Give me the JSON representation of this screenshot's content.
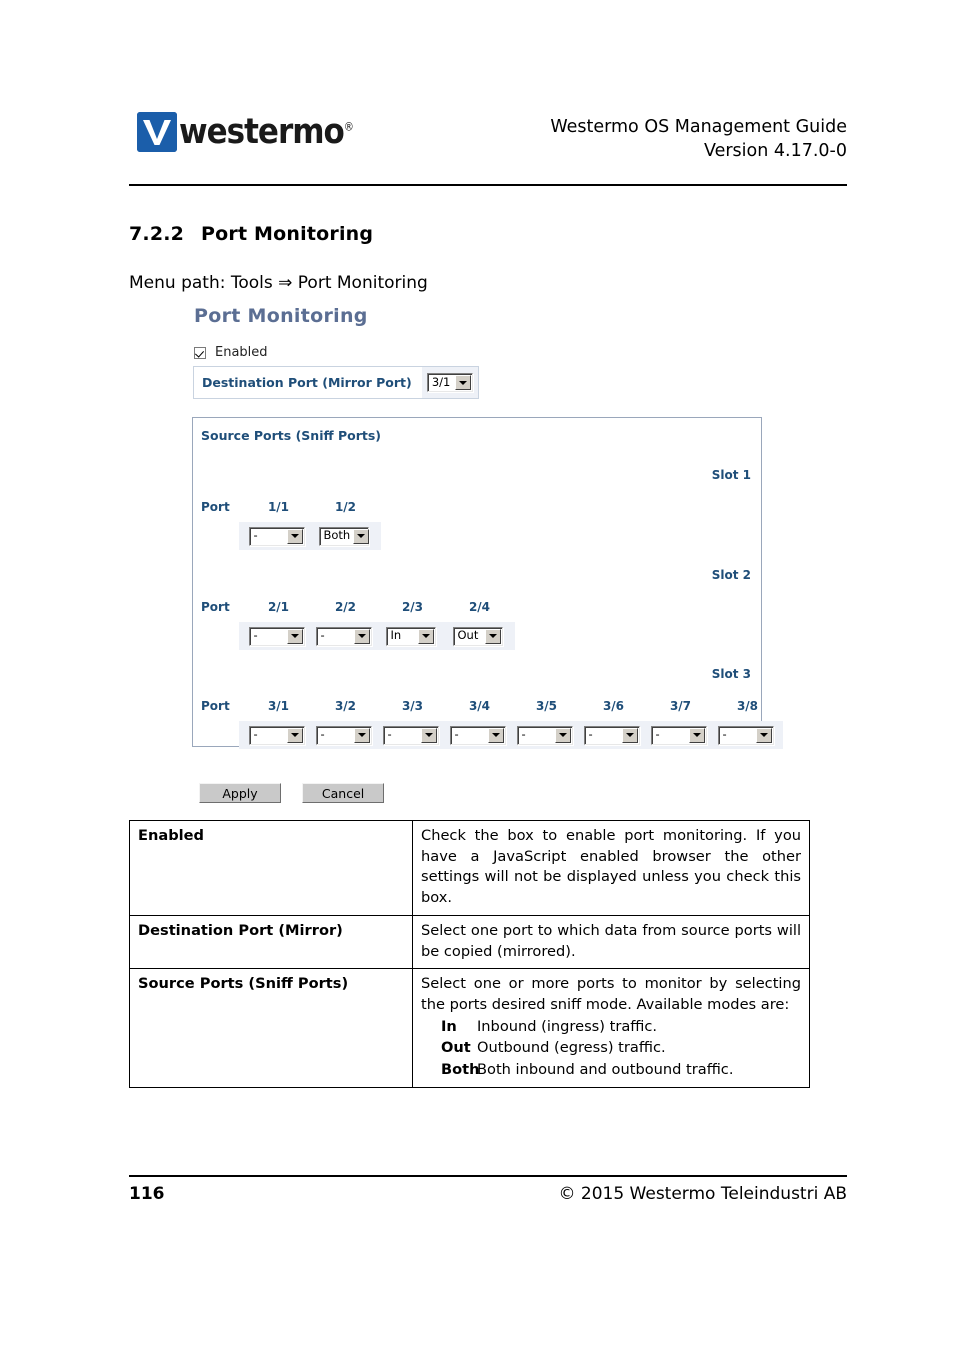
{
  "header": {
    "logo_word": "westermo",
    "logo_reg": "®",
    "title": "Westermo OS Management Guide",
    "version": "Version 4.17.0-0"
  },
  "section": {
    "number": "7.2.2",
    "heading": "Port Monitoring",
    "menu_path": "Menu path: Tools ⇒ Port Monitoring"
  },
  "webui": {
    "title": "Port Monitoring",
    "enabled_label": "Enabled",
    "enabled_checked": true,
    "destination": {
      "label": "Destination Port (Mirror Port)",
      "value": "3/1"
    },
    "source_ports": {
      "title": "Source Ports (Sniff Ports)",
      "port_label": "Port",
      "slots": [
        {
          "slot_label": "Slot 1",
          "ports": [
            {
              "name": "1/1",
              "value": "-"
            },
            {
              "name": "1/2",
              "value": "Both"
            }
          ]
        },
        {
          "slot_label": "Slot 2",
          "ports": [
            {
              "name": "2/1",
              "value": "-"
            },
            {
              "name": "2/2",
              "value": "-"
            },
            {
              "name": "2/3",
              "value": "In"
            },
            {
              "name": "2/4",
              "value": "Out"
            }
          ]
        },
        {
          "slot_label": "Slot 3",
          "ports": [
            {
              "name": "3/1",
              "value": "-"
            },
            {
              "name": "3/2",
              "value": "-"
            },
            {
              "name": "3/3",
              "value": "-"
            },
            {
              "name": "3/4",
              "value": "-"
            },
            {
              "name": "3/5",
              "value": "-"
            },
            {
              "name": "3/6",
              "value": "-"
            },
            {
              "name": "3/7",
              "value": "-"
            },
            {
              "name": "3/8",
              "value": "-"
            }
          ]
        }
      ]
    },
    "buttons": {
      "apply": "Apply",
      "cancel": "Cancel"
    }
  },
  "description_table": {
    "rows": [
      {
        "term": "Enabled",
        "definition": "Check the box to enable port monitoring. If you have a JavaScript enabled browser the other settings will not be displayed unless you check this box."
      },
      {
        "term": "Destination Port (Mirror)",
        "definition": "Select one port to which data from source ports will be copied (mirrored)."
      },
      {
        "term": "Source Ports (Sniff Ports)",
        "definition": "Select one or more ports to monitor by selecting the ports desired sniff mode. Available modes are:",
        "modes": [
          {
            "key": "In",
            "text": "Inbound (ingress) traffic."
          },
          {
            "key": "Out",
            "text": "Outbound (egress) traffic."
          },
          {
            "key": "Both",
            "text": "Both inbound and outbound traffic."
          }
        ]
      }
    ]
  },
  "footer": {
    "page_number": "116",
    "copyright": "© 2015 Westermo Teleindustri AB"
  },
  "colors": {
    "logo_blue": "#1b5eaa",
    "ui_title": "#5b6e93",
    "ui_accent": "#1f4e79",
    "panel_border": "#9aa7bb",
    "row_bg": "#eef1f7"
  }
}
